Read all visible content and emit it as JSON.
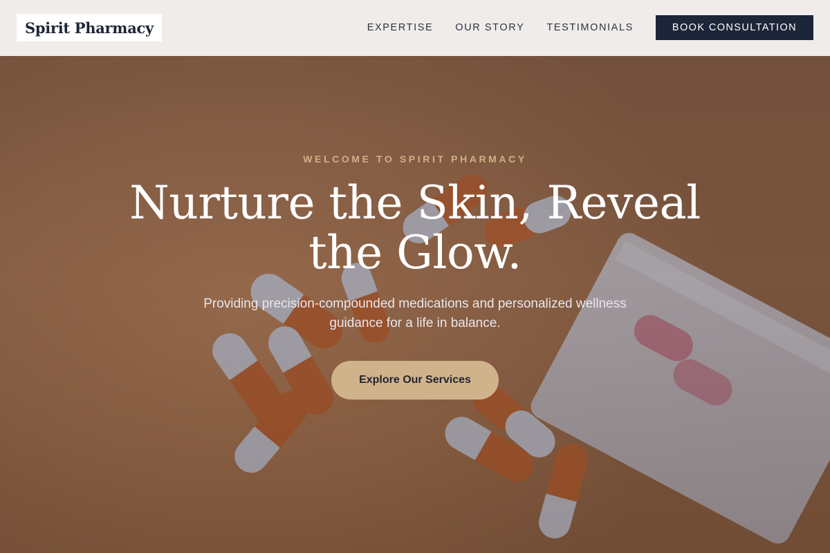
{
  "nav": {
    "brand": "Spirit Pharmacy",
    "links": [
      {
        "label": "EXPERTISE"
      },
      {
        "label": "OUR STORY"
      },
      {
        "label": "TESTIMONIALS"
      }
    ],
    "cta_label": "BOOK CONSULTATION"
  },
  "hero": {
    "eyebrow": "WELCOME TO SPIRIT PHARMACY",
    "headline": "Nurture the Skin, Reveal the Glow.",
    "subhead": "Providing precision-compounded medications and personalized wellness guidance for a life in balance.",
    "cta_label": "Explore Our Services",
    "background_image": "capsules-and-pill-bottle-photo"
  },
  "colors": {
    "navy": "#1d2638",
    "accent_gold": "#d1b38b",
    "eyebrow_gold": "#d1b088",
    "nav_bg": "#f3f2f0",
    "hero_orange": "#c17f48"
  }
}
